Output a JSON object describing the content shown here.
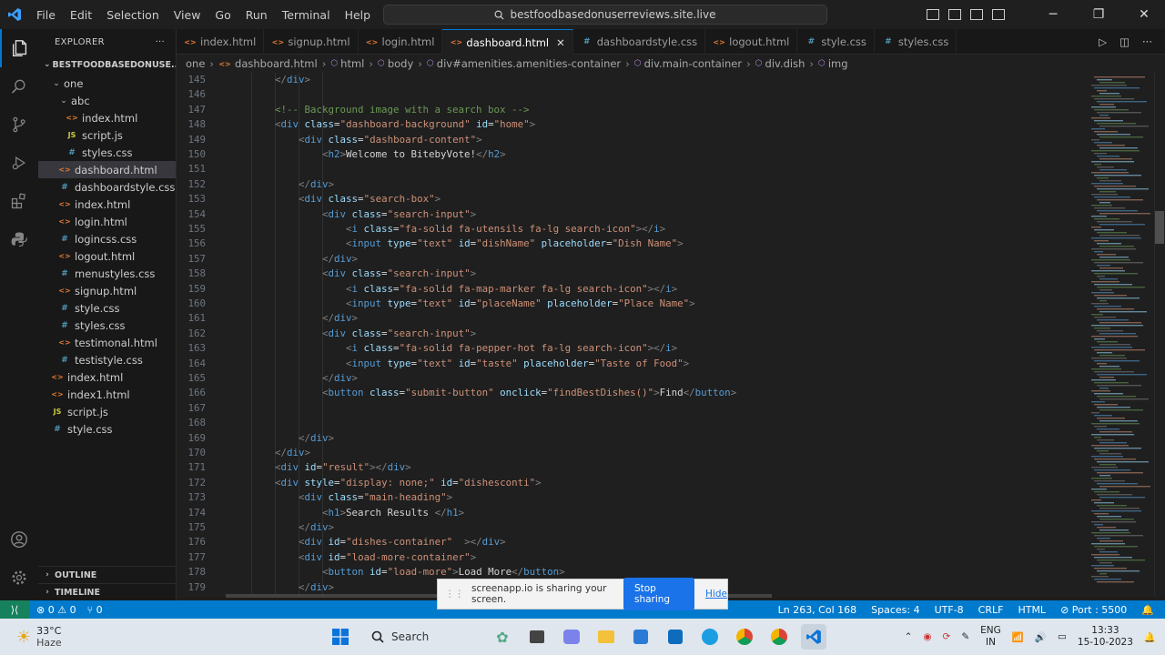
{
  "titlebar": {
    "menu": [
      "File",
      "Edit",
      "Selection",
      "View",
      "Go",
      "Run",
      "Terminal",
      "Help"
    ],
    "search_text": "bestfoodbasedonuserreviews.site.live"
  },
  "explorer": {
    "title": "EXPLORER",
    "root": "BESTFOODBASEDONUSE...",
    "items": [
      {
        "label": "one",
        "type": "folder",
        "depth": 1,
        "open": true
      },
      {
        "label": "abc",
        "type": "folder",
        "depth": 2,
        "open": true
      },
      {
        "label": "index.html",
        "type": "html",
        "depth": 3
      },
      {
        "label": "script.js",
        "type": "js",
        "depth": 3
      },
      {
        "label": "styles.css",
        "type": "css",
        "depth": 3
      },
      {
        "label": "dashboard.html",
        "type": "html",
        "depth": 2,
        "selected": true
      },
      {
        "label": "dashboardstyle.css",
        "type": "css",
        "depth": 2
      },
      {
        "label": "index.html",
        "type": "html",
        "depth": 2
      },
      {
        "label": "login.html",
        "type": "html",
        "depth": 2
      },
      {
        "label": "logincss.css",
        "type": "css",
        "depth": 2
      },
      {
        "label": "logout.html",
        "type": "html",
        "depth": 2
      },
      {
        "label": "menustyles.css",
        "type": "css",
        "depth": 2
      },
      {
        "label": "signup.html",
        "type": "html",
        "depth": 2
      },
      {
        "label": "style.css",
        "type": "css",
        "depth": 2
      },
      {
        "label": "styles.css",
        "type": "css",
        "depth": 2
      },
      {
        "label": "testimonal.html",
        "type": "html",
        "depth": 2
      },
      {
        "label": "testistyle.css",
        "type": "css",
        "depth": 2
      },
      {
        "label": "index.html",
        "type": "html",
        "depth": 1
      },
      {
        "label": "index1.html",
        "type": "html",
        "depth": 1
      },
      {
        "label": "script.js",
        "type": "js",
        "depth": 1
      },
      {
        "label": "style.css",
        "type": "css",
        "depth": 1
      }
    ],
    "outline": "OUTLINE",
    "timeline": "TIMELINE"
  },
  "tabs": [
    {
      "label": "index.html",
      "type": "html"
    },
    {
      "label": "signup.html",
      "type": "html"
    },
    {
      "label": "login.html",
      "type": "html"
    },
    {
      "label": "dashboard.html",
      "type": "html",
      "active": true
    },
    {
      "label": "dashboardstyle.css",
      "type": "css"
    },
    {
      "label": "logout.html",
      "type": "html"
    },
    {
      "label": "style.css",
      "type": "css"
    },
    {
      "label": "styles.css",
      "type": "css"
    }
  ],
  "breadcrumb": [
    "one",
    "dashboard.html",
    "html",
    "body",
    "div#amenities.amenities-container",
    "div.main-container",
    "div.dish",
    "img"
  ],
  "code_lines": [
    {
      "n": "145",
      "i": 2,
      "s": [
        [
          "b",
          "</"
        ],
        [
          "tag",
          "div"
        ],
        [
          "b",
          ">"
        ]
      ]
    },
    {
      "n": "146",
      "i": 0,
      "s": []
    },
    {
      "n": "147",
      "i": 2,
      "s": [
        [
          "cm",
          "<!-- Background image with a search box -->"
        ]
      ]
    },
    {
      "n": "148",
      "i": 2,
      "s": [
        [
          "b",
          "<"
        ],
        [
          "tag",
          "div "
        ],
        [
          "at",
          "class"
        ],
        [
          "tx",
          "="
        ],
        [
          "st",
          "\"dashboard-background\" "
        ],
        [
          "at",
          "id"
        ],
        [
          "tx",
          "="
        ],
        [
          "st",
          "\"home\""
        ],
        [
          "b",
          ">"
        ]
      ]
    },
    {
      "n": "149",
      "i": 3,
      "s": [
        [
          "b",
          "<"
        ],
        [
          "tag",
          "div "
        ],
        [
          "at",
          "class"
        ],
        [
          "tx",
          "="
        ],
        [
          "st",
          "\"dashboard-content\""
        ],
        [
          "b",
          ">"
        ]
      ]
    },
    {
      "n": "150",
      "i": 4,
      "s": [
        [
          "b",
          "<"
        ],
        [
          "tag",
          "h2"
        ],
        [
          "b",
          ">"
        ],
        [
          "tx",
          "Welcome to BitebyVote!"
        ],
        [
          "b",
          "</"
        ],
        [
          "tag",
          "h2"
        ],
        [
          "b",
          ">"
        ]
      ]
    },
    {
      "n": "151",
      "i": 0,
      "s": []
    },
    {
      "n": "152",
      "i": 3,
      "s": [
        [
          "b",
          "</"
        ],
        [
          "tag",
          "div"
        ],
        [
          "b",
          ">"
        ]
      ]
    },
    {
      "n": "153",
      "i": 3,
      "s": [
        [
          "b",
          "<"
        ],
        [
          "tag",
          "div "
        ],
        [
          "at",
          "class"
        ],
        [
          "tx",
          "="
        ],
        [
          "st",
          "\"search-box\""
        ],
        [
          "b",
          ">"
        ]
      ]
    },
    {
      "n": "154",
      "i": 4,
      "s": [
        [
          "b",
          "<"
        ],
        [
          "tag",
          "div "
        ],
        [
          "at",
          "class"
        ],
        [
          "tx",
          "="
        ],
        [
          "st",
          "\"search-input\""
        ],
        [
          "b",
          ">"
        ]
      ]
    },
    {
      "n": "155",
      "i": 5,
      "s": [
        [
          "b",
          "<"
        ],
        [
          "tag",
          "i "
        ],
        [
          "at",
          "class"
        ],
        [
          "tx",
          "="
        ],
        [
          "st",
          "\"fa-solid fa-utensils fa-lg search-icon\""
        ],
        [
          "b",
          "></"
        ],
        [
          "tag",
          "i"
        ],
        [
          "b",
          ">"
        ]
      ]
    },
    {
      "n": "156",
      "i": 5,
      "s": [
        [
          "b",
          "<"
        ],
        [
          "tag",
          "input "
        ],
        [
          "at",
          "type"
        ],
        [
          "tx",
          "="
        ],
        [
          "st",
          "\"text\" "
        ],
        [
          "at",
          "id"
        ],
        [
          "tx",
          "="
        ],
        [
          "st",
          "\"dishName\" "
        ],
        [
          "at",
          "placeholder"
        ],
        [
          "tx",
          "="
        ],
        [
          "st",
          "\"Dish Name\""
        ],
        [
          "b",
          ">"
        ]
      ]
    },
    {
      "n": "157",
      "i": 4,
      "s": [
        [
          "b",
          "</"
        ],
        [
          "tag",
          "div"
        ],
        [
          "b",
          ">"
        ]
      ]
    },
    {
      "n": "158",
      "i": 4,
      "s": [
        [
          "b",
          "<"
        ],
        [
          "tag",
          "div "
        ],
        [
          "at",
          "class"
        ],
        [
          "tx",
          "="
        ],
        [
          "st",
          "\"search-input\""
        ],
        [
          "b",
          ">"
        ]
      ]
    },
    {
      "n": "159",
      "i": 5,
      "s": [
        [
          "b",
          "<"
        ],
        [
          "tag",
          "i "
        ],
        [
          "at",
          "class"
        ],
        [
          "tx",
          "="
        ],
        [
          "st",
          "\"fa-solid fa-map-marker fa-lg search-icon\""
        ],
        [
          "b",
          "></"
        ],
        [
          "tag",
          "i"
        ],
        [
          "b",
          ">"
        ]
      ]
    },
    {
      "n": "160",
      "i": 5,
      "s": [
        [
          "b",
          "<"
        ],
        [
          "tag",
          "input "
        ],
        [
          "at",
          "type"
        ],
        [
          "tx",
          "="
        ],
        [
          "st",
          "\"text\" "
        ],
        [
          "at",
          "id"
        ],
        [
          "tx",
          "="
        ],
        [
          "st",
          "\"placeName\" "
        ],
        [
          "at",
          "placeholder"
        ],
        [
          "tx",
          "="
        ],
        [
          "st",
          "\"Place Name\""
        ],
        [
          "b",
          ">"
        ]
      ]
    },
    {
      "n": "161",
      "i": 4,
      "s": [
        [
          "b",
          "</"
        ],
        [
          "tag",
          "div"
        ],
        [
          "b",
          ">"
        ]
      ]
    },
    {
      "n": "162",
      "i": 4,
      "s": [
        [
          "b",
          "<"
        ],
        [
          "tag",
          "div "
        ],
        [
          "at",
          "class"
        ],
        [
          "tx",
          "="
        ],
        [
          "st",
          "\"search-input\""
        ],
        [
          "b",
          ">"
        ]
      ]
    },
    {
      "n": "163",
      "i": 5,
      "s": [
        [
          "b",
          "<"
        ],
        [
          "tag",
          "i "
        ],
        [
          "at",
          "class"
        ],
        [
          "tx",
          "="
        ],
        [
          "st",
          "\"fa-solid fa-pepper-hot fa-lg search-icon\""
        ],
        [
          "b",
          "></"
        ],
        [
          "tag",
          "i"
        ],
        [
          "b",
          ">"
        ]
      ]
    },
    {
      "n": "164",
      "i": 5,
      "s": [
        [
          "b",
          "<"
        ],
        [
          "tag",
          "input "
        ],
        [
          "at",
          "type"
        ],
        [
          "tx",
          "="
        ],
        [
          "st",
          "\"text\" "
        ],
        [
          "at",
          "id"
        ],
        [
          "tx",
          "="
        ],
        [
          "st",
          "\"taste\" "
        ],
        [
          "at",
          "placeholder"
        ],
        [
          "tx",
          "="
        ],
        [
          "st",
          "\"Taste of Food\""
        ],
        [
          "b",
          ">"
        ]
      ]
    },
    {
      "n": "165",
      "i": 4,
      "s": [
        [
          "b",
          "</"
        ],
        [
          "tag",
          "div"
        ],
        [
          "b",
          ">"
        ]
      ]
    },
    {
      "n": "166",
      "i": 4,
      "s": [
        [
          "b",
          "<"
        ],
        [
          "tag",
          "button "
        ],
        [
          "at",
          "class"
        ],
        [
          "tx",
          "="
        ],
        [
          "st",
          "\"submit-button\" "
        ],
        [
          "at",
          "onclick"
        ],
        [
          "tx",
          "="
        ],
        [
          "st",
          "\"findBestDishes()\""
        ],
        [
          "b",
          ">"
        ],
        [
          "tx",
          "Find"
        ],
        [
          "b",
          "</"
        ],
        [
          "tag",
          "button"
        ],
        [
          "b",
          ">"
        ]
      ]
    },
    {
      "n": "167",
      "i": 0,
      "s": []
    },
    {
      "n": "168",
      "i": 0,
      "s": []
    },
    {
      "n": "169",
      "i": 3,
      "s": [
        [
          "b",
          "</"
        ],
        [
          "tag",
          "div"
        ],
        [
          "b",
          ">"
        ]
      ]
    },
    {
      "n": "170",
      "i": 2,
      "s": [
        [
          "b",
          "</"
        ],
        [
          "tag",
          "div"
        ],
        [
          "b",
          ">"
        ]
      ]
    },
    {
      "n": "171",
      "i": 2,
      "s": [
        [
          "b",
          "<"
        ],
        [
          "tag",
          "div "
        ],
        [
          "at",
          "id"
        ],
        [
          "tx",
          "="
        ],
        [
          "st",
          "\"result\""
        ],
        [
          "b",
          "></"
        ],
        [
          "tag",
          "div"
        ],
        [
          "b",
          ">"
        ]
      ]
    },
    {
      "n": "172",
      "i": 2,
      "s": [
        [
          "b",
          "<"
        ],
        [
          "tag",
          "div "
        ],
        [
          "at",
          "style"
        ],
        [
          "tx",
          "="
        ],
        [
          "st",
          "\"display: none;\" "
        ],
        [
          "at",
          "id"
        ],
        [
          "tx",
          "="
        ],
        [
          "st",
          "\"dishesconti\""
        ],
        [
          "b",
          ">"
        ]
      ]
    },
    {
      "n": "173",
      "i": 3,
      "s": [
        [
          "b",
          "<"
        ],
        [
          "tag",
          "div "
        ],
        [
          "at",
          "class"
        ],
        [
          "tx",
          "="
        ],
        [
          "st",
          "\"main-heading\""
        ],
        [
          "b",
          ">"
        ]
      ]
    },
    {
      "n": "174",
      "i": 4,
      "s": [
        [
          "b",
          "<"
        ],
        [
          "tag",
          "h1"
        ],
        [
          "b",
          ">"
        ],
        [
          "tx",
          "Search Results "
        ],
        [
          "b",
          "</"
        ],
        [
          "tag",
          "h1"
        ],
        [
          "b",
          ">"
        ]
      ]
    },
    {
      "n": "175",
      "i": 3,
      "s": [
        [
          "b",
          "</"
        ],
        [
          "tag",
          "div"
        ],
        [
          "b",
          ">"
        ]
      ]
    },
    {
      "n": "176",
      "i": 3,
      "s": [
        [
          "b",
          "<"
        ],
        [
          "tag",
          "div "
        ],
        [
          "at",
          "id"
        ],
        [
          "tx",
          "="
        ],
        [
          "st",
          "\"dishes-container\"  "
        ],
        [
          "b",
          "></"
        ],
        [
          "tag",
          "div"
        ],
        [
          "b",
          ">"
        ]
      ]
    },
    {
      "n": "177",
      "i": 3,
      "s": [
        [
          "b",
          "<"
        ],
        [
          "tag",
          "div "
        ],
        [
          "at",
          "id"
        ],
        [
          "tx",
          "="
        ],
        [
          "st",
          "\"load-more-container\""
        ],
        [
          "b",
          ">"
        ]
      ]
    },
    {
      "n": "178",
      "i": 4,
      "s": [
        [
          "b",
          "<"
        ],
        [
          "tag",
          "button "
        ],
        [
          "at",
          "id"
        ],
        [
          "tx",
          "="
        ],
        [
          "st",
          "\"load-more\""
        ],
        [
          "b",
          ">"
        ],
        [
          "tx",
          "Load More"
        ],
        [
          "b",
          "</"
        ],
        [
          "tag",
          "button"
        ],
        [
          "b",
          ">"
        ]
      ]
    },
    {
      "n": "179",
      "i": 3,
      "s": [
        [
          "b",
          "</"
        ],
        [
          "tag",
          "div"
        ],
        [
          "b",
          ">"
        ]
      ]
    }
  ],
  "statusbar": {
    "problems": "⊗ 0 ⚠ 0",
    "ports_count": "⑂ 0",
    "position": "Ln 263, Col 168",
    "spaces": "Spaces: 4",
    "encoding": "UTF-8",
    "eol": "CRLF",
    "language": "HTML",
    "port": "⊘ Port : 5500"
  },
  "share_bar": {
    "message": "screenapp.io is sharing your screen.",
    "stop": "Stop sharing",
    "hide": "Hide"
  },
  "taskbar": {
    "temp": "33°C",
    "condition": "Haze",
    "search": "Search",
    "lang1": "ENG",
    "lang2": "IN",
    "time": "13:33",
    "date": "15-10-2023"
  },
  "colors": {
    "accent": "#0078d4",
    "statusbar": "#007acc",
    "remote": "#16825d"
  }
}
